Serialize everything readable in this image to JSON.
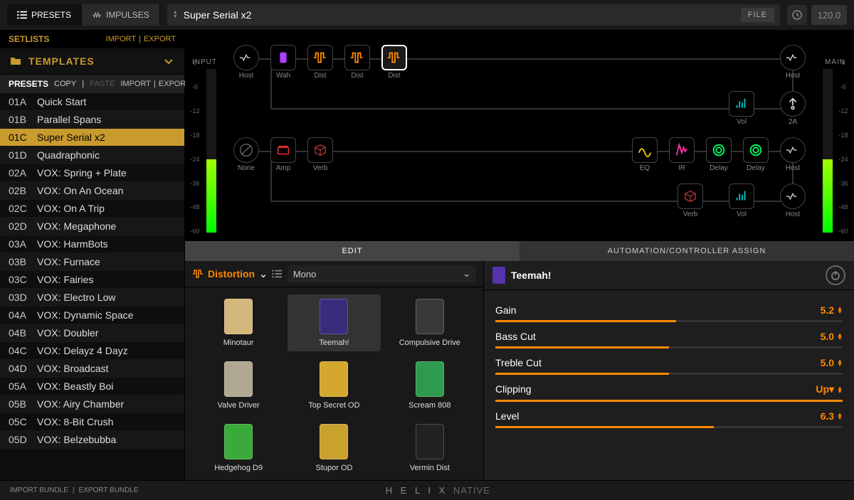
{
  "header": {
    "tabs": {
      "presets": "PRESETS",
      "impulses": "IMPULSES"
    },
    "preset_name": "Super Serial x2",
    "file_label": "FILE",
    "tempo": "120.0"
  },
  "sidebar": {
    "setlists_label": "SETLISTS",
    "import_label": "IMPORT",
    "export_label": "EXPORT",
    "templates_label": "TEMPLATES",
    "presets_header": {
      "label": "PRESETS",
      "copy": "COPY",
      "paste": "PASTE",
      "import": "IMPORT",
      "export": "EXPORT"
    },
    "items": [
      {
        "slot": "01A",
        "name": "Quick Start"
      },
      {
        "slot": "01B",
        "name": "Parallel Spans"
      },
      {
        "slot": "01C",
        "name": "Super Serial x2",
        "selected": true
      },
      {
        "slot": "01D",
        "name": "Quadraphonic"
      },
      {
        "slot": "02A",
        "name": "VOX: Spring + Plate"
      },
      {
        "slot": "02B",
        "name": "VOX: On An Ocean"
      },
      {
        "slot": "02C",
        "name": "VOX: On A Trip"
      },
      {
        "slot": "02D",
        "name": "VOX: Megaphone"
      },
      {
        "slot": "03A",
        "name": "VOX: HarmBots"
      },
      {
        "slot": "03B",
        "name": "VOX: Furnace"
      },
      {
        "slot": "03C",
        "name": "VOX: Fairies"
      },
      {
        "slot": "03D",
        "name": "VOX: Electro Low"
      },
      {
        "slot": "04A",
        "name": "VOX: Dynamic Space"
      },
      {
        "slot": "04B",
        "name": "VOX: Doubler"
      },
      {
        "slot": "04C",
        "name": "VOX: Delayz 4 Dayz"
      },
      {
        "slot": "04D",
        "name": "VOX: Broadcast"
      },
      {
        "slot": "05A",
        "name": "VOX: Beastly Boi"
      },
      {
        "slot": "05B",
        "name": "VOX: Airy Chamber"
      },
      {
        "slot": "05C",
        "name": "VOX: 8-Bit Crush"
      },
      {
        "slot": "05D",
        "name": "VOX: Belzebubba"
      }
    ]
  },
  "signal": {
    "input_label": "INPUT",
    "main_label": "MAIN",
    "meter_ticks": [
      "0",
      "-6",
      "-12",
      "-18",
      "-24",
      "-36",
      "-48",
      "-60"
    ],
    "rows": [
      {
        "nodes": [
          {
            "label": "Host",
            "shape": "round",
            "color": ""
          },
          {
            "label": "Wah",
            "color": "c-purple"
          },
          {
            "label": "Dist",
            "color": "c-orange"
          },
          {
            "label": "Dist",
            "color": "c-orange"
          },
          {
            "label": "Dist",
            "color": "c-orange",
            "selected": true
          }
        ],
        "right": {
          "label": "Host",
          "shape": "round"
        },
        "sub": [
          {
            "label": "Vol",
            "color": "c-teal"
          },
          {
            "label": "2A",
            "shape": "round"
          }
        ]
      },
      {
        "nodes": [
          {
            "label": "None",
            "shape": "round"
          },
          {
            "label": "Amp",
            "color": "c-red"
          },
          {
            "label": "Verb",
            "color": "c-maroon"
          }
        ],
        "right_group": [
          {
            "label": "EQ",
            "color": "c-yellow"
          },
          {
            "label": "IR",
            "color": "c-pink"
          },
          {
            "label": "Delay",
            "color": "c-green"
          },
          {
            "label": "Delay",
            "color": "c-green"
          },
          {
            "label": "Host",
            "shape": "round"
          }
        ],
        "sub": [
          {
            "label": "Verb",
            "color": "c-maroon"
          },
          {
            "label": "Vol",
            "color": "c-teal"
          },
          {
            "label": "Host",
            "shape": "round"
          }
        ]
      }
    ]
  },
  "editor": {
    "tabs": {
      "edit": "EDIT",
      "automation": "AUTOMATION/CONTROLLER ASSIGN"
    },
    "category": "Distortion",
    "channel_mode": "Mono",
    "models": [
      {
        "name": "Minotaur",
        "color": "#d4b77a"
      },
      {
        "name": "Teemah!",
        "color": "#3a2c7d",
        "selected": true
      },
      {
        "name": "Compulsive Drive",
        "color": "#3a3a3a"
      },
      {
        "name": "Valve Driver",
        "color": "#b0a890"
      },
      {
        "name": "Top Secret OD",
        "color": "#d4a82e"
      },
      {
        "name": "Scream 808",
        "color": "#2e9a4e"
      },
      {
        "name": "Hedgehog D9",
        "color": "#3aaa3a"
      },
      {
        "name": "Stupor OD",
        "color": "#c9a22e"
      },
      {
        "name": "Vermin Dist",
        "color": "#222"
      }
    ],
    "selected_model": "Teemah!",
    "params": [
      {
        "name": "Gain",
        "value": "5.2",
        "pct": 52
      },
      {
        "name": "Bass Cut",
        "value": "5.0",
        "pct": 50
      },
      {
        "name": "Treble Cut",
        "value": "5.0",
        "pct": 50
      },
      {
        "name": "Clipping",
        "value": "Up",
        "pct": 100,
        "is_enum": true
      },
      {
        "name": "Level",
        "value": "6.3",
        "pct": 63
      }
    ]
  },
  "footer": {
    "import_bundle": "IMPORT BUNDLE",
    "export_bundle": "EXPORT BUNDLE",
    "brand_helix": "H E L I X",
    "brand_native": "NATIVE"
  }
}
